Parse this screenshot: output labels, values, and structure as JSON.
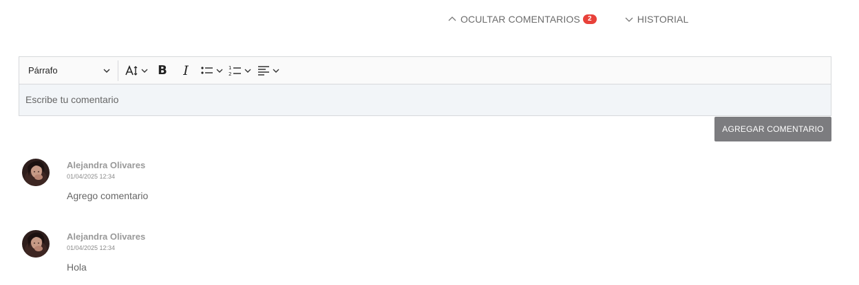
{
  "header_links": {
    "hide_comments_label": "OCULTAR COMENTARIOS",
    "comment_count": "2",
    "history_label": "HISTORIAL"
  },
  "editor": {
    "format_select_value": "Párrafo",
    "placeholder": "Escribe tu comentario",
    "toolbar_icons": [
      "font-size-icon",
      "bold-icon",
      "italic-icon",
      "bulleted-list-icon",
      "numbered-list-icon",
      "align-left-icon"
    ]
  },
  "add_comment_button": "AGREGAR COMENTARIO",
  "comments": [
    {
      "author": "Alejandra Olivares",
      "date": "01/04/2025 12:34",
      "text": "Agrego comentario"
    },
    {
      "author": "Alejandra Olivares",
      "date": "01/04/2025 12:34",
      "text": "Hola"
    }
  ],
  "colors": {
    "badge": "#e8413a",
    "button": "#7c7c7f",
    "editor_background": "#f2f5f8"
  }
}
